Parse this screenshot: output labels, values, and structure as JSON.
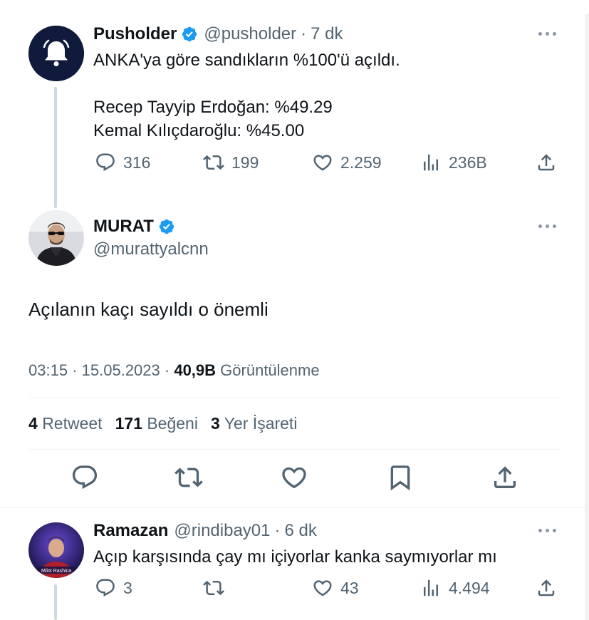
{
  "tweet1": {
    "display_name": "Pusholder",
    "handle": "@pusholder",
    "time": "7 dk",
    "text": "ANKA'ya göre sandıkların %100'ü açıldı.\n\nRecep Tayyip Erdoğan: %49.29\nKemal Kılıçdaroğlu: %45.00",
    "replies": "316",
    "retweets": "199",
    "likes": "2.259",
    "views": "236B",
    "avatar_icon": "bell-icon",
    "avatar_color": "#0f1a3c"
  },
  "main_tweet": {
    "display_name": "MURAT",
    "handle": "@murattyalcnn",
    "text": "Açılanın kaçı sayıldı o önemli",
    "time": "03:15",
    "date": "15.05.2023",
    "views_count": "40,9B",
    "views_label": "Görüntülenme",
    "retweet_count": "4",
    "retweet_label": "Retweet",
    "like_count": "171",
    "like_label": "Beğeni",
    "bookmark_count": "3",
    "bookmark_label": "Yer İşareti"
  },
  "reply": {
    "display_name": "Ramazan",
    "handle": "@rindibay01",
    "time": "6 dk",
    "text": "Açıp karşısında çay mı içiyorlar kanka saymıyorlar mı",
    "replies": "3",
    "likes": "43",
    "views": "4.494",
    "avatar_caption": "Milot Rashica"
  },
  "separator": "·",
  "colors": {
    "verified": "#1d9bf0",
    "text": "#0f1419",
    "secondary": "#536471",
    "thread_line": "#cfd9de"
  }
}
